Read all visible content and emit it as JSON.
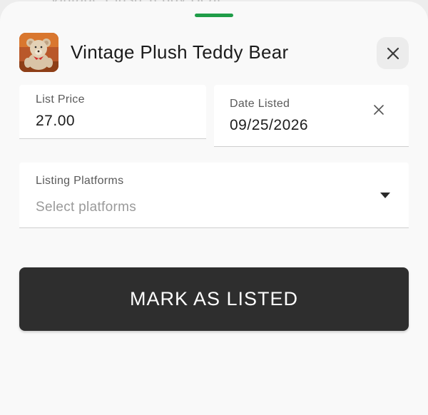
{
  "backdrop": {
    "text": "Vintage Plush Teddy Bear"
  },
  "sheet": {
    "title": "Vintage Plush Teddy Bear",
    "thumbnail_icon": "teddy-bear-image",
    "close_icon": "close-icon",
    "accent_color": "#1f9d48"
  },
  "form": {
    "list_price": {
      "label": "List Price",
      "value": "27.00"
    },
    "date_listed": {
      "label": "Date Listed",
      "value": "09/25/2026",
      "clear_icon": "clear-icon"
    },
    "listing_platforms": {
      "label": "Listing Platforms",
      "placeholder": "Select platforms",
      "icon": "dropdown-arrow-icon"
    }
  },
  "actions": {
    "primary_label": "MARK AS LISTED",
    "primary_color": "#2e2e2e"
  }
}
